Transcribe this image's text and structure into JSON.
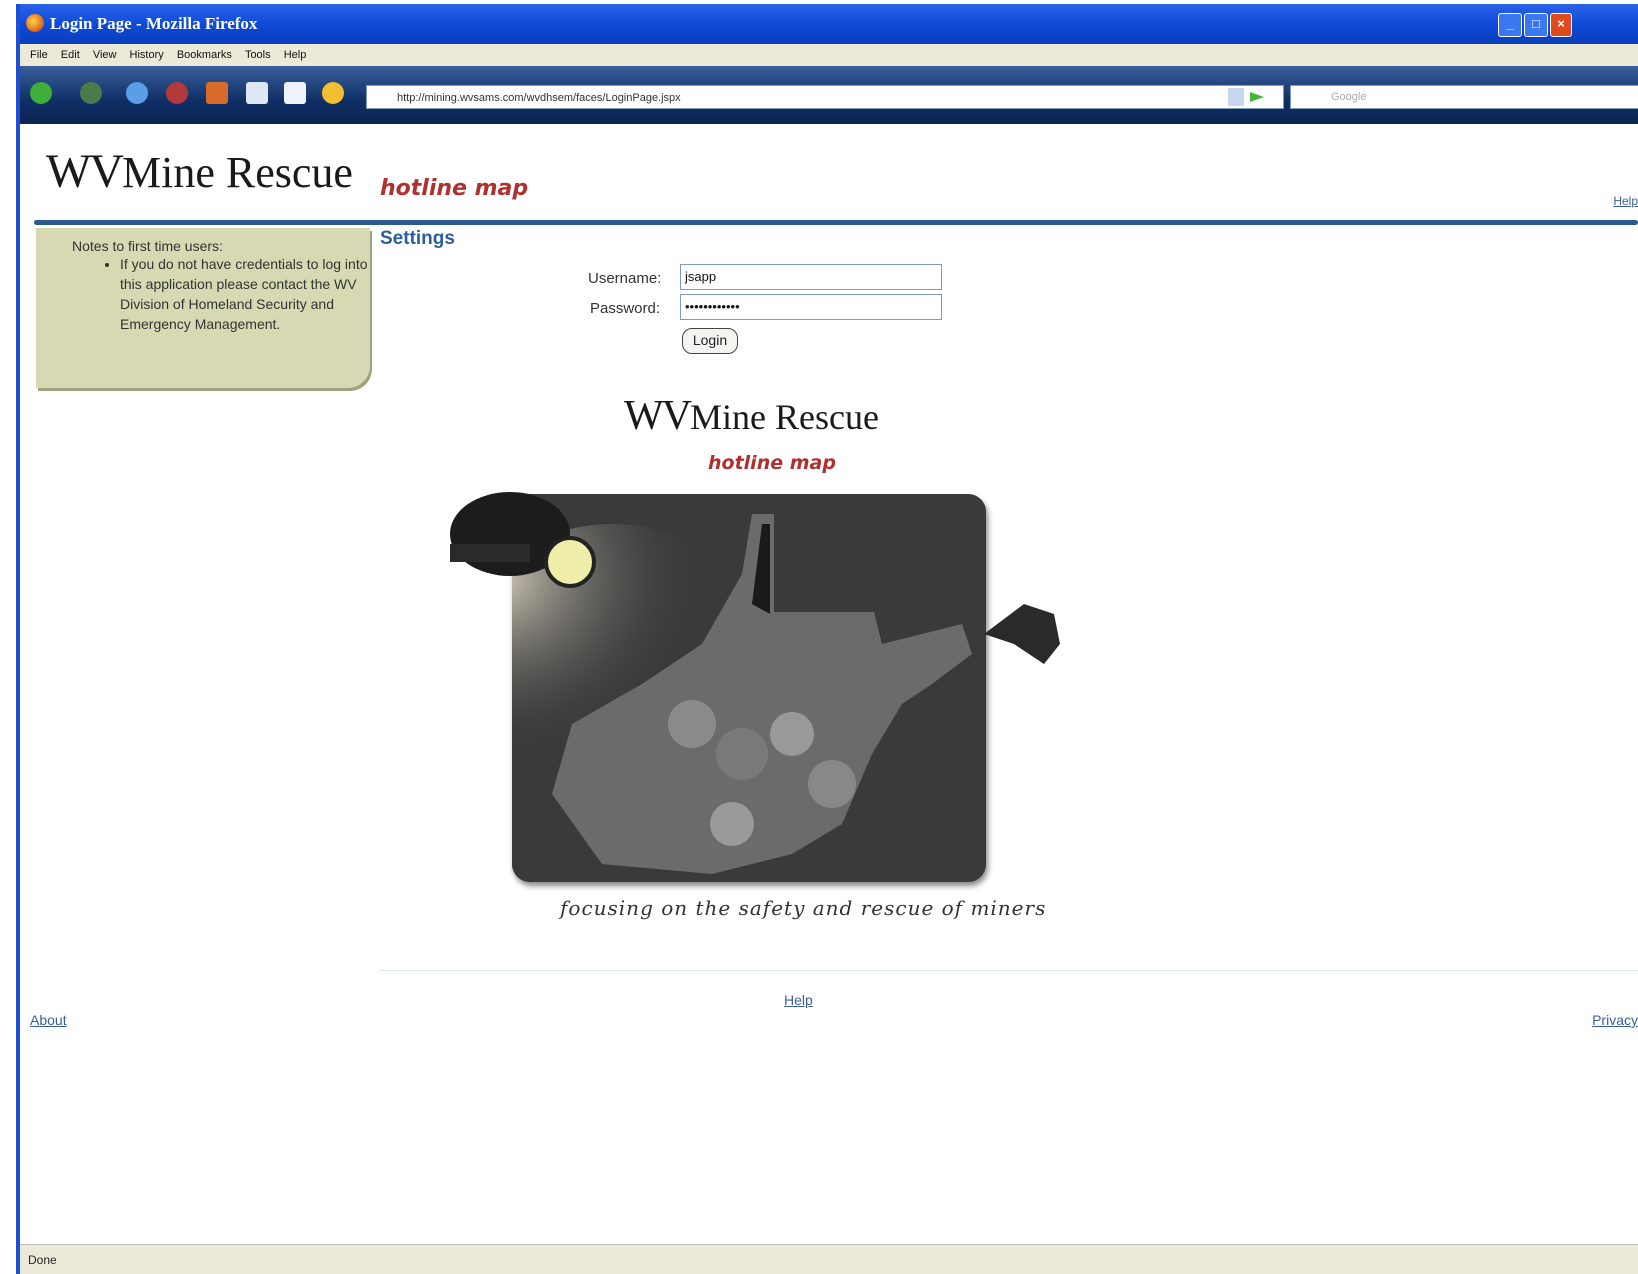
{
  "window": {
    "title": "Login Page - Mozilla Firefox"
  },
  "menu": [
    "File",
    "Edit",
    "View",
    "History",
    "Bookmarks",
    "Tools",
    "Help"
  ],
  "toolbar": {
    "url": "http://mining.wvsams.com/wvdhsem/faces/LoginPage.jspx",
    "search_placeholder": "Google"
  },
  "header": {
    "logo_text_wv": "WV",
    "logo_text_mine": "Mine Rescue",
    "subtitle": "hotline map",
    "help_link": "Help"
  },
  "notes": {
    "title": "Notes to first time users:",
    "items": [
      "If you do not have credentials to log into this application please contact the WV Division of Homeland Security and Emergency Management."
    ]
  },
  "settings": {
    "title": "Settings",
    "username_label": "Username:",
    "username_value": "jsapp",
    "password_label": "Password:",
    "password_value": "••••••••••••",
    "login_button": "Login"
  },
  "splash": {
    "logo_text_wv": "WV",
    "logo_text_mine": "Mine Rescue",
    "subtitle": "hotline map",
    "tagline": "focusing on the safety and rescue of miners"
  },
  "footer": {
    "help": "Help",
    "about": "About",
    "privacy": "Privacy"
  },
  "status": {
    "text": "Done"
  },
  "colors": {
    "titlebar": "#0d49d6",
    "accent_red": "#b03030",
    "link_blue": "#3a5f9a",
    "notes_bg": "#d6d9b1"
  }
}
